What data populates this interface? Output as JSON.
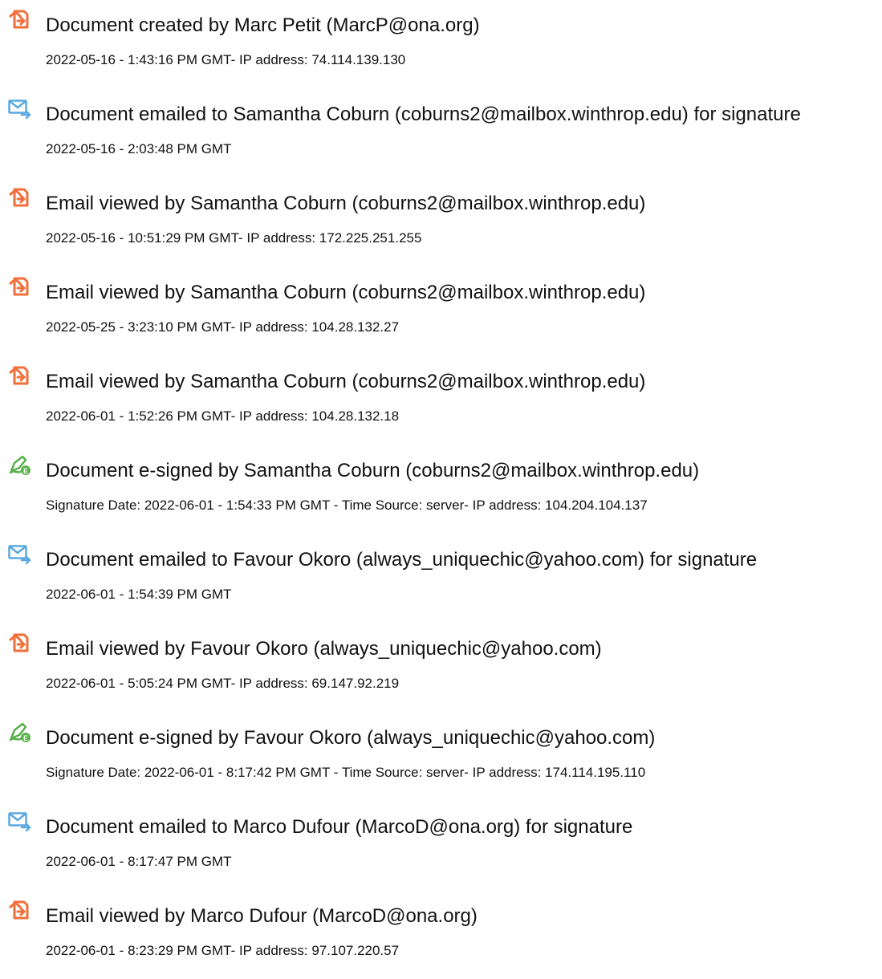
{
  "colors": {
    "view_icon": "#f26e3a",
    "email_icon": "#5aa8e0",
    "sign_icon": "#58b04b",
    "text": "#111111"
  },
  "events": [
    {
      "icon": "document-view-icon",
      "title": "Document created by Marc Petit (MarcP@ona.org)",
      "detail": "2022-05-16 - 1:43:16 PM GMT- IP address: 74.114.139.130"
    },
    {
      "icon": "email-sent-icon",
      "title": "Document emailed to Samantha Coburn (coburns2@mailbox.winthrop.edu) for signature",
      "detail": "2022-05-16 - 2:03:48 PM GMT"
    },
    {
      "icon": "document-view-icon",
      "title": "Email viewed by Samantha Coburn (coburns2@mailbox.winthrop.edu)",
      "detail": "2022-05-16 - 10:51:29 PM GMT- IP address: 172.225.251.255"
    },
    {
      "icon": "document-view-icon",
      "title": "Email viewed by Samantha Coburn (coburns2@mailbox.winthrop.edu)",
      "detail": "2022-05-25 - 3:23:10 PM GMT- IP address: 104.28.132.27"
    },
    {
      "icon": "document-view-icon",
      "title": "Email viewed by Samantha Coburn (coburns2@mailbox.winthrop.edu)",
      "detail": "2022-06-01 - 1:52:26 PM GMT- IP address: 104.28.132.18"
    },
    {
      "icon": "e-sign-icon",
      "title": "Document e-signed by Samantha Coburn (coburns2@mailbox.winthrop.edu)",
      "detail": "Signature Date: 2022-06-01 - 1:54:33 PM GMT - Time Source: server- IP address: 104.204.104.137"
    },
    {
      "icon": "email-sent-icon",
      "title": "Document emailed to Favour Okoro (always_uniquechic@yahoo.com) for signature",
      "detail": "2022-06-01 - 1:54:39 PM GMT"
    },
    {
      "icon": "document-view-icon",
      "title": "Email viewed by Favour Okoro (always_uniquechic@yahoo.com)",
      "detail": "2022-06-01 - 5:05:24 PM GMT- IP address: 69.147.92.219"
    },
    {
      "icon": "e-sign-icon",
      "title": "Document e-signed by Favour Okoro (always_uniquechic@yahoo.com)",
      "detail": "Signature Date: 2022-06-01 - 8:17:42 PM GMT - Time Source: server- IP address: 174.114.195.110"
    },
    {
      "icon": "email-sent-icon",
      "title": "Document emailed to Marco Dufour (MarcoD@ona.org) for signature",
      "detail": "2022-06-01 - 8:17:47 PM GMT"
    },
    {
      "icon": "document-view-icon",
      "title": "Email viewed by Marco Dufour (MarcoD@ona.org)",
      "detail": "2022-06-01 - 8:23:29 PM GMT- IP address: 97.107.220.57"
    }
  ]
}
